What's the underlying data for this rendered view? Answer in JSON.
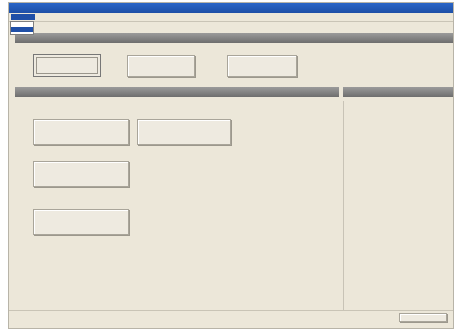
{
  "window": {
    "title": ""
  },
  "menubar": {
    "items": [
      {
        "label": ""
      },
      {
        "label": ""
      },
      {
        "label": ""
      }
    ]
  },
  "dropdown": {
    "items": [
      {
        "label": ""
      },
      {
        "label": ""
      }
    ]
  },
  "top_section": {
    "header": "",
    "buttons": [
      {
        "label": ""
      },
      {
        "label": ""
      },
      {
        "label": ""
      }
    ]
  },
  "left_section": {
    "header": "",
    "buttons": [
      {
        "label": ""
      },
      {
        "label": ""
      },
      {
        "label": ""
      },
      {
        "label": ""
      }
    ]
  },
  "right_section": {
    "header": ""
  },
  "statusbar": {
    "left_1": "",
    "left_2": "",
    "right_1": "",
    "right_2": "",
    "action_button": ""
  }
}
